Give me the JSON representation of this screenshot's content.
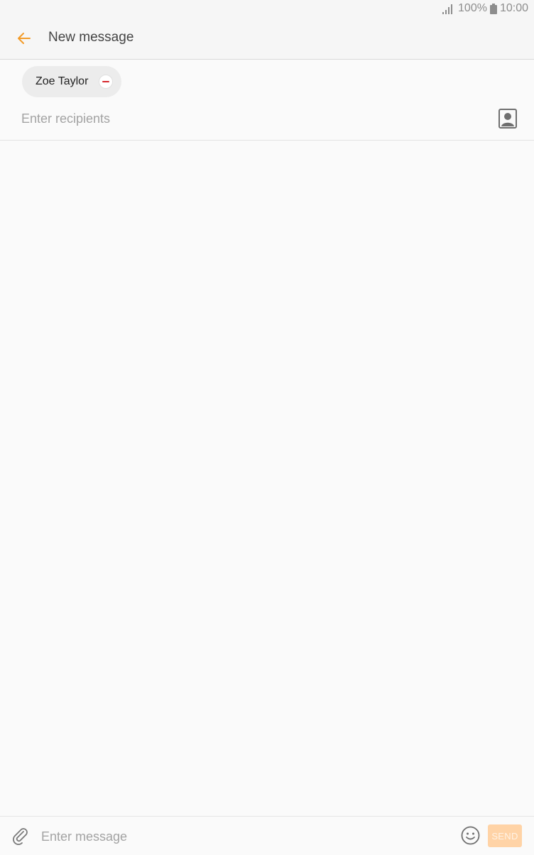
{
  "status_bar": {
    "battery_level": "100%",
    "time": "10:00",
    "icons": [
      "signal-icon",
      "battery-icon"
    ]
  },
  "app_bar": {
    "back_icon": "arrow-left-icon",
    "title": "New message"
  },
  "recipients": {
    "chips": [
      {
        "label": "Zoe Taylor",
        "remove_icon": "minus-circle-icon"
      }
    ],
    "input_placeholder": "Enter recipients",
    "input_value": "",
    "contacts_icon": "contact-card-icon"
  },
  "compose": {
    "attach_icon": "paperclip-icon",
    "message_placeholder": "Enter message",
    "message_value": "",
    "emoji_icon": "smiley-icon",
    "send_label": "SEND"
  },
  "colors": {
    "accent": "#f39b28",
    "send_disabled_bg": "#ffd3a6",
    "remove_red": "#d6262c"
  }
}
